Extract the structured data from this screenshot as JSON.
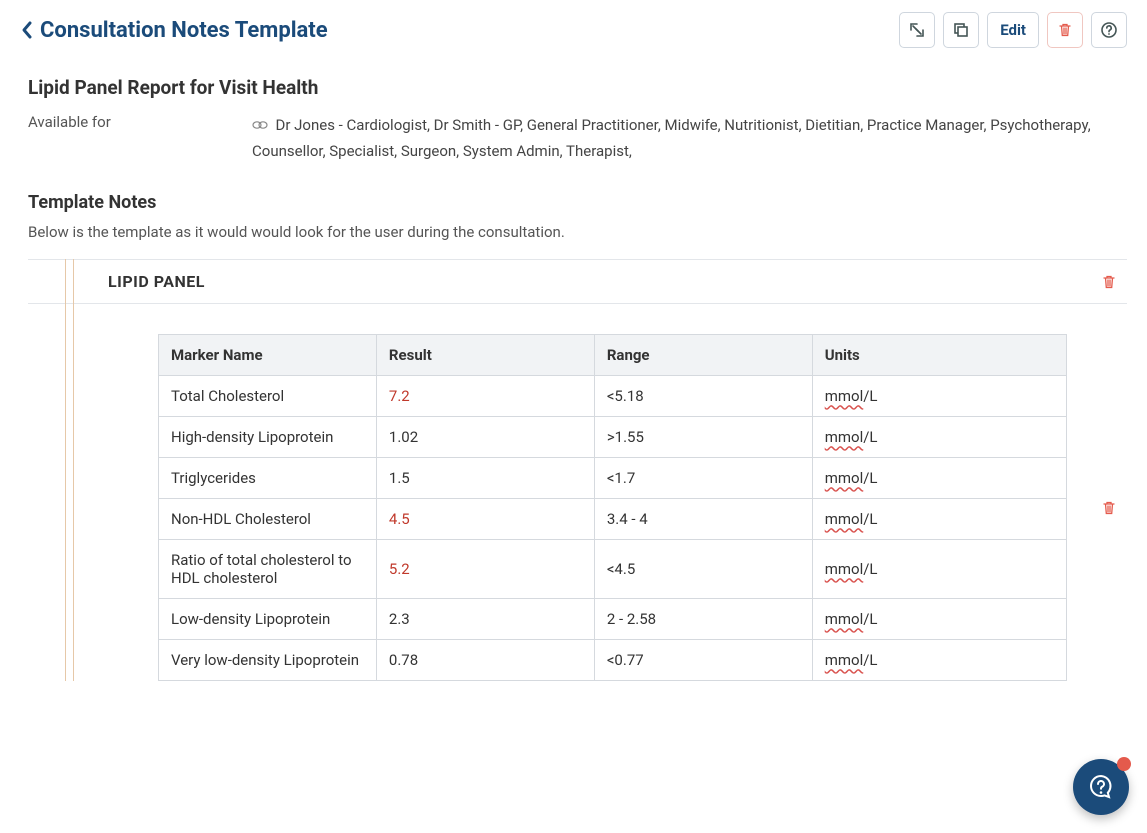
{
  "header": {
    "title": "Consultation Notes Template",
    "edit_label": "Edit"
  },
  "report": {
    "title": "Lipid Panel Report for Visit Health",
    "available_label": "Available for",
    "available_for": "Dr Jones - Cardiologist,  Dr Smith - GP,  General Practitioner,  Midwife,  Nutritionist, Dietitian,  Practice Manager,  Psychotherapy, Counsellor,  Specialist,  Surgeon,  System Admin,  Therapist,"
  },
  "notes": {
    "heading": "Template Notes",
    "desc": "Below is the template as it would would look for the user during the consultation."
  },
  "panel": {
    "label": "LIPID PANEL"
  },
  "table": {
    "headers": {
      "marker": "Marker Name",
      "result": "Result",
      "range": "Range",
      "units": "Units"
    },
    "rows": [
      {
        "marker": "Total Cholesterol",
        "result": "7.2",
        "range": "<5.18",
        "unit_prefix": "mmol",
        "unit_suffix": "/L",
        "abnormal": true
      },
      {
        "marker": "High-density Lipoprotein",
        "result": "1.02",
        "range": ">1.55",
        "unit_prefix": "mmol",
        "unit_suffix": "/L",
        "abnormal": false
      },
      {
        "marker": "Triglycerides",
        "result": "1.5",
        "range": "<1.7",
        "unit_prefix": "mmol",
        "unit_suffix": "/L",
        "abnormal": false
      },
      {
        "marker": "Non-HDL Cholesterol",
        "result": "4.5",
        "range": "3.4 - 4",
        "unit_prefix": "mmol",
        "unit_suffix": "/L",
        "abnormal": true
      },
      {
        "marker": "Ratio of total cholesterol to HDL cholesterol",
        "result": "5.2",
        "range": "<4.5",
        "unit_prefix": "mmol",
        "unit_suffix": "/L",
        "abnormal": true
      },
      {
        "marker": "Low-density Lipoprotein",
        "result": "2.3",
        "range": "2 - 2.58",
        "unit_prefix": "mmol",
        "unit_suffix": "/L",
        "abnormal": false
      },
      {
        "marker": "Very low-density Lipoprotein",
        "result": "0.78",
        "range": "<0.77",
        "unit_prefix": "mmol",
        "unit_suffix": "/L",
        "abnormal": false
      }
    ]
  }
}
